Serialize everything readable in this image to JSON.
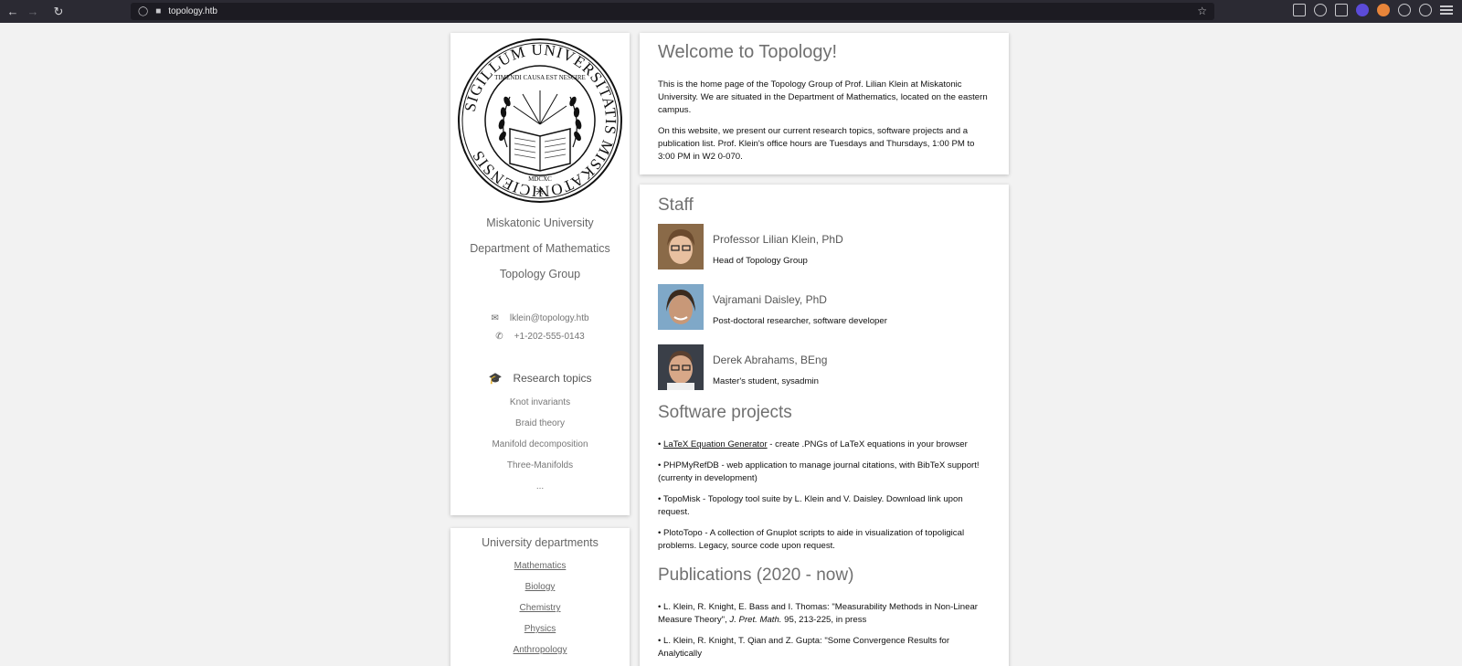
{
  "browser": {
    "url": "topology.htb"
  },
  "sidebar": {
    "university": "Miskatonic University",
    "department": "Department of Mathematics",
    "group": "Topology Group",
    "email": "lklein@topology.htb",
    "phone": "+1-202-555-0143",
    "research_heading": "Research topics",
    "topics": [
      "Knot invariants",
      "Braid theory",
      "Manifold decomposition",
      "Three-Manifolds",
      "..."
    ]
  },
  "seal": {
    "outer_text": "SIGILLUM UNIVERSITATIS MISKATONICIENSIS",
    "inner_text": "TIMENDI CAUSA EST NESCIRE",
    "year": "MDCXC"
  },
  "departments": {
    "title": "University departments",
    "links": [
      "Mathematics",
      "Biology",
      "Chemistry",
      "Physics",
      "Anthropology"
    ]
  },
  "welcome": {
    "title": "Welcome to Topology!",
    "p1": "This is the home page of the Topology Group of Prof. Lilian Klein at Miskatonic University. We are situated in the Department of Mathematics, located on the eastern campus.",
    "p2": "On this website, we present our current research topics, software projects and a publication list. Prof. Klein's office hours are Tuesdays and Thursdays, 1:00 PM to 3:00 PM in W2 0-070."
  },
  "staff": {
    "title": "Staff",
    "members": [
      {
        "name": "Professor Lilian Klein, PhD",
        "role": "Head of Topology Group"
      },
      {
        "name": "Vajramani Daisley, PhD",
        "role": "Post-doctoral researcher, software developer"
      },
      {
        "name": "Derek Abrahams, BEng",
        "role": "Master's student, sysadmin"
      }
    ]
  },
  "software": {
    "title": "Software projects",
    "items": [
      {
        "bullet": "•",
        "link": "LaTeX Equation Generator",
        "text": " - create .PNGs of LaTeX equations in your browser"
      },
      {
        "bullet": "•",
        "text": "PHPMyRefDB - web application to manage journal citations, with BibTeX support! (currenty in development)"
      },
      {
        "bullet": "•",
        "text": "TopoMisk - Topology tool suite by L. Klein and V. Daisley. Download link upon request."
      },
      {
        "bullet": "•",
        "text": "PlotoTopo - A collection of Gnuplot scripts to aide in visualization of topoligical problems. Legacy, source code upon request."
      }
    ]
  },
  "publications": {
    "title": "Publications (2020 - now)",
    "items": [
      {
        "bullet": "•",
        "authors": "L. Klein, R. Knight, E. Bass and I. Thomas: \"Measurability Methods in Non-Linear Measure Theory\", ",
        "journal": "J. Pret. Math.",
        "rest": " 95, 213-225, in press"
      },
      {
        "bullet": "•",
        "authors": "L. Klein, R. Knight, T. Qian and Z. Gupta: \"Some Convergence Results for Analytically",
        "journal": "",
        "rest": ""
      }
    ]
  },
  "colors": {
    "page_bg": "#f2f2f2",
    "chrome_bg": "#2b2a33",
    "heading": "#707070"
  }
}
